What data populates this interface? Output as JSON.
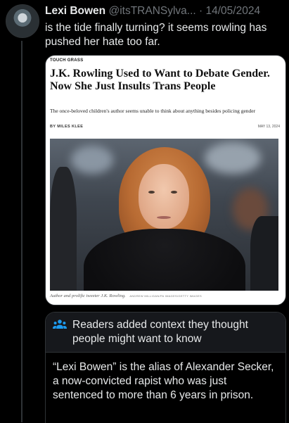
{
  "tweet": {
    "author_name": "Lexi Bowen",
    "handle": "@itsTRANSylva...",
    "separator": "·",
    "date": "14/05/2024",
    "text": "is the tide finally turning? it seems rowling has pushed her hate too far."
  },
  "article_card": {
    "section": "TOUCH GRASS",
    "title": "J.K. Rowling Used to Want to Debate Gender. Now She Just Insults Trans People",
    "subtitle": "The once-beloved children's author seems unable to think about anything besides policing gender",
    "byline": "BY MILES KLEE",
    "date": "MAY 13, 2024",
    "photo_caption": "Author and prolific tweeter J.K. Rowling.",
    "photo_credit": "ANDREW MILLIGAN/PA IMAGES/GETTY IMAGES"
  },
  "community_note": {
    "icon": "people-icon",
    "title": "Readers added context they thought people might want to know",
    "body": "“Lexi Bowen” is the alias of Alexander Secker, a now-convicted rapist who was just sentenced to more than 6 years in prison."
  },
  "colors": {
    "background": "#000000",
    "text_primary": "#e7e9ea",
    "text_secondary": "#71767b",
    "border": "#2f3336",
    "note_header_bg": "#16181c",
    "note_icon": "#1d9bf0"
  }
}
